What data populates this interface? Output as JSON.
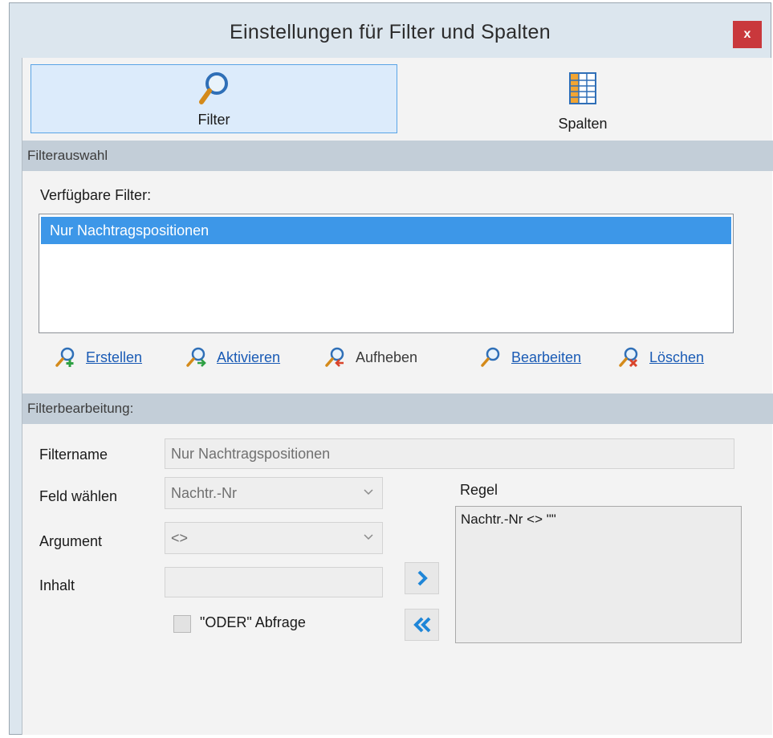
{
  "window": {
    "title": "Einstellungen für Filter und Spalten",
    "close_label": "x"
  },
  "tabs": [
    {
      "label": "Filter",
      "icon": "search-icon"
    },
    {
      "label": "Spalten",
      "icon": "table-columns-icon"
    }
  ],
  "filter_selection": {
    "header": "Filterauswahl",
    "available_label": "Verfügbare Filter:",
    "items": [
      "Nur Nachtragspositionen"
    ]
  },
  "actions": [
    {
      "label": "Erstellen",
      "icon": "filter-add-icon"
    },
    {
      "label": "Aktivieren",
      "icon": "filter-activate-icon"
    },
    {
      "label": "Aufheben",
      "icon": "filter-remove-icon"
    },
    {
      "label": "Bearbeiten",
      "icon": "filter-edit-icon"
    },
    {
      "label": "Löschen",
      "icon": "filter-delete-icon"
    }
  ],
  "filter_edit": {
    "header": "Filterbearbeitung:",
    "name_label": "Filtername",
    "name_value": "Nur Nachtragspositionen",
    "field_label": "Feld wählen",
    "field_value": "Nachtr.-Nr",
    "argument_label": "Argument",
    "argument_value": "<>",
    "content_label": "Inhalt",
    "content_value": "",
    "or_label": "\"ODER\" Abfrage",
    "or_checked": false,
    "rule_label": "Regel",
    "rule_value": "Nachtr.-Nr <> \"\""
  },
  "colors": {
    "accent": "#3d97e8",
    "section": "#c3ced8",
    "link": "#1a5bb5",
    "arrow": "#1f86d8",
    "close": "#c9383c"
  }
}
